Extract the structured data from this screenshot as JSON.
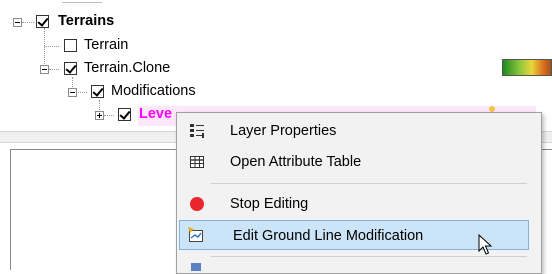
{
  "tree": {
    "terrains": {
      "label": "Terrains",
      "checked": true,
      "expanded": true
    },
    "terrain": {
      "label": "Terrain",
      "checked": false
    },
    "terrain_clone": {
      "label": "Terrain.Clone",
      "checked": true,
      "expanded": true
    },
    "modifications": {
      "label": "Modifications",
      "checked": true,
      "expanded": true
    },
    "level": {
      "label": "Leve",
      "checked": true,
      "expanded": false,
      "color": "#ff00ff",
      "highlight": "#fde8fb"
    }
  },
  "context_menu": {
    "items": [
      {
        "label": "Layer Properties",
        "icon": "layer-properties-icon"
      },
      {
        "label": "Open Attribute Table",
        "icon": "attribute-table-icon"
      },
      {
        "label": "Stop Editing",
        "icon": "stop-editing-icon",
        "color": "#e8262c"
      },
      {
        "label": "Edit Ground Line Modification",
        "icon": "ground-line-edit-icon",
        "highlighted": true
      }
    ]
  },
  "colors": {
    "menu_bg": "#f2f2f2",
    "highlight_bg": "#cce4f7",
    "highlight_border": "#7fb2e0",
    "layer_highlight": "#fde8fb"
  }
}
